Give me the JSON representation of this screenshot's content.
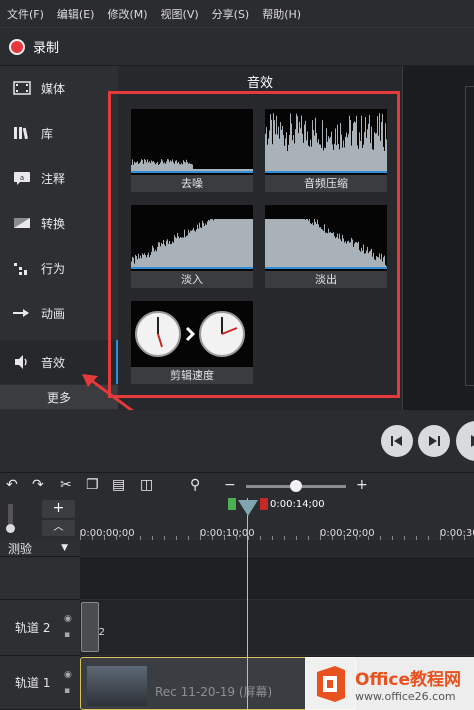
{
  "menu": [
    "文件(F)",
    "编辑(E)",
    "修改(M)",
    "视图(V)",
    "分享(S)",
    "帮助(H)"
  ],
  "record_label": "录制",
  "sidebar": {
    "items": [
      {
        "label": "媒体",
        "icon": "film-icon"
      },
      {
        "label": "库",
        "icon": "library-icon"
      },
      {
        "label": "注释",
        "icon": "annotation-icon"
      },
      {
        "label": "转换",
        "icon": "transition-icon"
      },
      {
        "label": "行为",
        "icon": "behavior-icon"
      },
      {
        "label": "动画",
        "icon": "animation-icon"
      },
      {
        "label": "音效",
        "icon": "speaker-icon"
      }
    ],
    "more_label": "更多"
  },
  "panel": {
    "title": "音效",
    "tiles": [
      "去噪",
      "音频压缩",
      "淡入",
      "淡出",
      "剪辑速度"
    ]
  },
  "timeline": {
    "time_labels": [
      "0:00:00;00",
      "0:00:10;00",
      "0:00:20;00",
      "0:00:30"
    ],
    "playhead_time": "0:00:14;00",
    "marker_label": "测验",
    "tracks": [
      "轨道 2",
      "轨道 1"
    ],
    "clip_label": "Rec 11-20-19 (屏幕)",
    "clip_small_label": "2"
  },
  "watermark": {
    "brand": "Office教程网",
    "url": "www.office26.com"
  },
  "colors": {
    "accent": "#2f8fd8",
    "highlight": "#e53a3a",
    "record": "#e6383d",
    "brand": "#e8521e"
  }
}
